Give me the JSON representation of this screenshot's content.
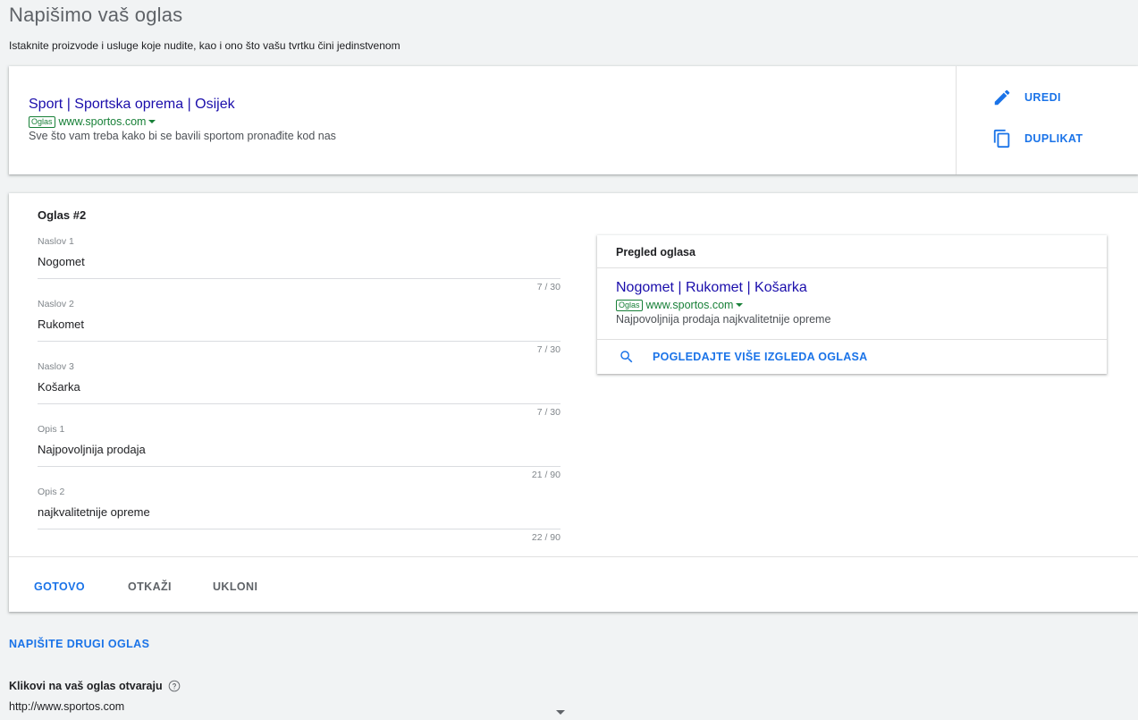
{
  "header": {
    "title": "Napišimo vaš oglas",
    "subtitle": "Istaknite proizvode i usluge koje nudite, kao i ono što vašu tvrtku čini jedinstvenom"
  },
  "ad_card": {
    "headline": "Sport | Sportska oprema | Osijek",
    "badge": "Oglas",
    "url": "www.sportos.com",
    "description": "Sve što vam treba kako bi se bavili sportom pronađite kod nas",
    "edit_label": "UREDI",
    "duplicate_label": "DUPLIKAT"
  },
  "editor": {
    "title": "Oglas #2",
    "fields": [
      {
        "label": "Naslov 1",
        "value": "Nogomet",
        "counter": "7 / 30"
      },
      {
        "label": "Naslov 2",
        "value": "Rukomet",
        "counter": "7 / 30"
      },
      {
        "label": "Naslov 3",
        "value": "Košarka",
        "counter": "7 / 30"
      },
      {
        "label": "Opis 1",
        "value": "Najpovoljnija prodaja",
        "counter": "21 / 90"
      },
      {
        "label": "Opis 2",
        "value": "najkvalitetnije opreme",
        "counter": "22 / 90"
      }
    ],
    "done_label": "GOTOVO",
    "cancel_label": "OTKAŽI",
    "remove_label": "UKLONI"
  },
  "preview": {
    "header": "Pregled oglasa",
    "headline": "Nogomet | Rukomet | Košarka",
    "badge": "Oglas",
    "url": "www.sportos.com",
    "description": "Najpovoljnija prodaja najkvalitetnije opreme",
    "more_label": "POGLEDAJTE VIŠE IZGLEDA OGLASA"
  },
  "write_another_label": "NAPIŠITE DRUGI OGLAS",
  "clicks": {
    "label": "Klikovi na vaš oglas otvaraju",
    "selected_url": "http://www.sportos.com"
  },
  "colors": {
    "accent": "#1a73e8",
    "headline_link": "#1a0dab",
    "ad_green": "#188038",
    "background": "#f1f3f4"
  },
  "icons": {
    "edit": "pencil-icon",
    "duplicate": "copy-icon",
    "search": "search-icon",
    "help": "help-circle-icon",
    "dropdown": "chevron-down-icon"
  }
}
